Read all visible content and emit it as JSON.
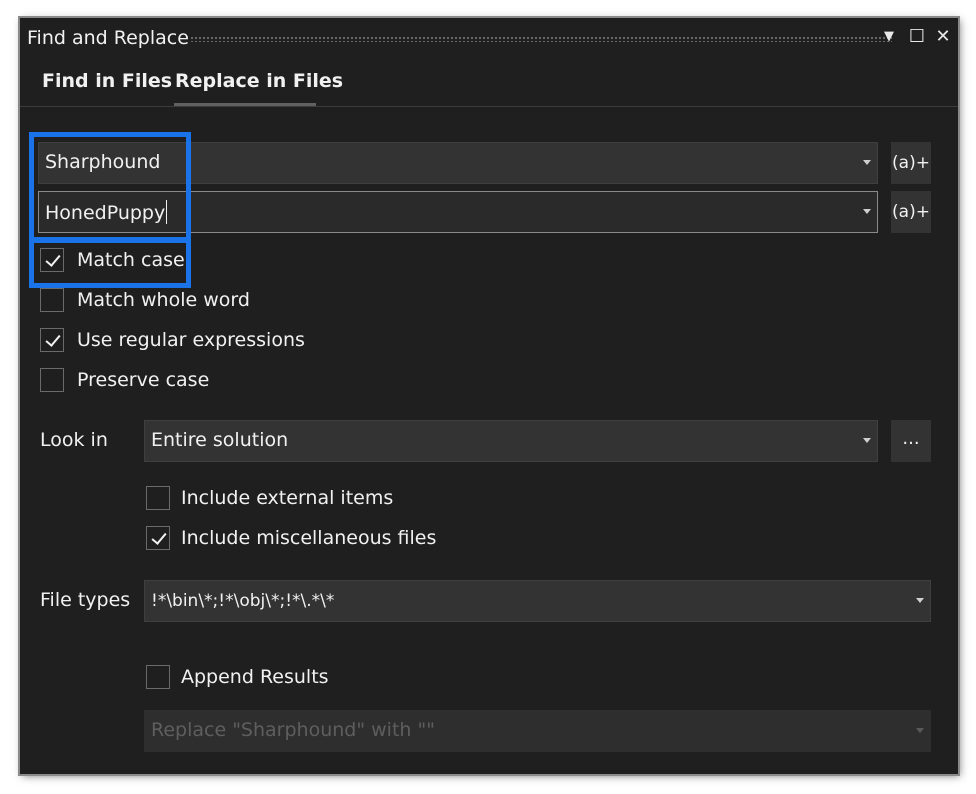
{
  "window": {
    "title": "Find and Replace"
  },
  "titlebar": {
    "dropdown_glyph": "▼",
    "maximize_glyph": "☐",
    "close_glyph": "✕"
  },
  "tabs": [
    {
      "label": "Find in Files",
      "active": false
    },
    {
      "label": "Replace in Files",
      "active": true
    }
  ],
  "find": {
    "value": "Sharphound",
    "regex_button": "(a)+"
  },
  "replace": {
    "value": "HonedPuppy",
    "regex_button": "(a)+"
  },
  "options": [
    {
      "label": "Match case",
      "checked": true
    },
    {
      "label": "Match whole word",
      "checked": false
    },
    {
      "label": "Use regular expressions",
      "checked": true
    },
    {
      "label": "Preserve case",
      "checked": false
    }
  ],
  "look_in": {
    "label": "Look in",
    "value": "Entire solution",
    "browse_button": "..."
  },
  "scope_options": [
    {
      "label": "Include external items",
      "checked": false
    },
    {
      "label": "Include miscellaneous files",
      "checked": true
    }
  ],
  "file_types": {
    "label": "File types",
    "value": "!*\\bin\\*;!*\\obj\\*;!*\\.*\\*"
  },
  "append_results": {
    "label": "Append Results",
    "checked": false
  },
  "results": {
    "value": "Replace \"Sharphound\" with \"\""
  },
  "highlight_color": "#1a73e8",
  "theme": {
    "background": "#1f1f1f",
    "field": "#333333",
    "text": "#f1f1f1"
  }
}
